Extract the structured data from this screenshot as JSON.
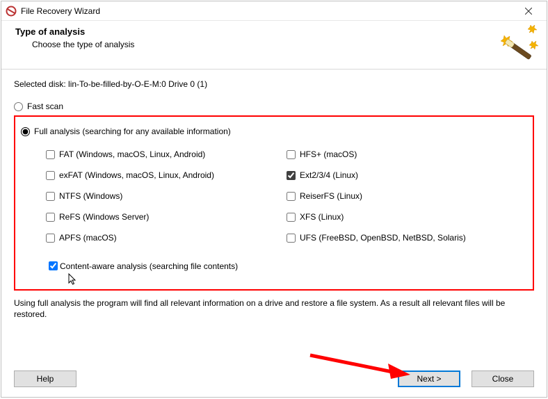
{
  "titlebar": {
    "title": "File Recovery Wizard"
  },
  "header": {
    "title": "Type of analysis",
    "subtitle": "Choose the type of analysis"
  },
  "content": {
    "selected_disk_label": "Selected disk: ",
    "selected_disk_value": "lin-To-be-filled-by-O-E-M:0 Drive 0 (1)",
    "scan_modes": {
      "fast": {
        "label": "Fast scan",
        "selected": false
      },
      "full": {
        "label": "Full analysis (searching for any available information)",
        "selected": true
      }
    },
    "filesystems": {
      "left": [
        {
          "label": "FAT (Windows, macOS, Linux, Android)",
          "checked": false
        },
        {
          "label": "exFAT (Windows, macOS, Linux, Android)",
          "checked": false
        },
        {
          "label": "NTFS (Windows)",
          "checked": false
        },
        {
          "label": "ReFS (Windows Server)",
          "checked": false
        },
        {
          "label": "APFS (macOS)",
          "checked": false
        }
      ],
      "right": [
        {
          "label": "HFS+ (macOS)",
          "checked": false
        },
        {
          "label": "Ext2/3/4 (Linux)",
          "checked": true
        },
        {
          "label": "ReiserFS (Linux)",
          "checked": false
        },
        {
          "label": "XFS (Linux)",
          "checked": false
        },
        {
          "label": "UFS (FreeBSD, OpenBSD, NetBSD, Solaris)",
          "checked": false
        }
      ]
    },
    "content_aware": {
      "label": "Content-aware analysis (searching file contents)",
      "checked": true
    },
    "description": "Using full analysis the program will find all relevant information on a drive and restore a file system. As a result all relevant files will be restored."
  },
  "buttons": {
    "help": "Help",
    "next": "Next >",
    "close": "Close"
  },
  "annotation": {
    "highlight_border_color": "#ff0000",
    "arrow_color": "#ff0000",
    "arrow_target": "next-button"
  }
}
